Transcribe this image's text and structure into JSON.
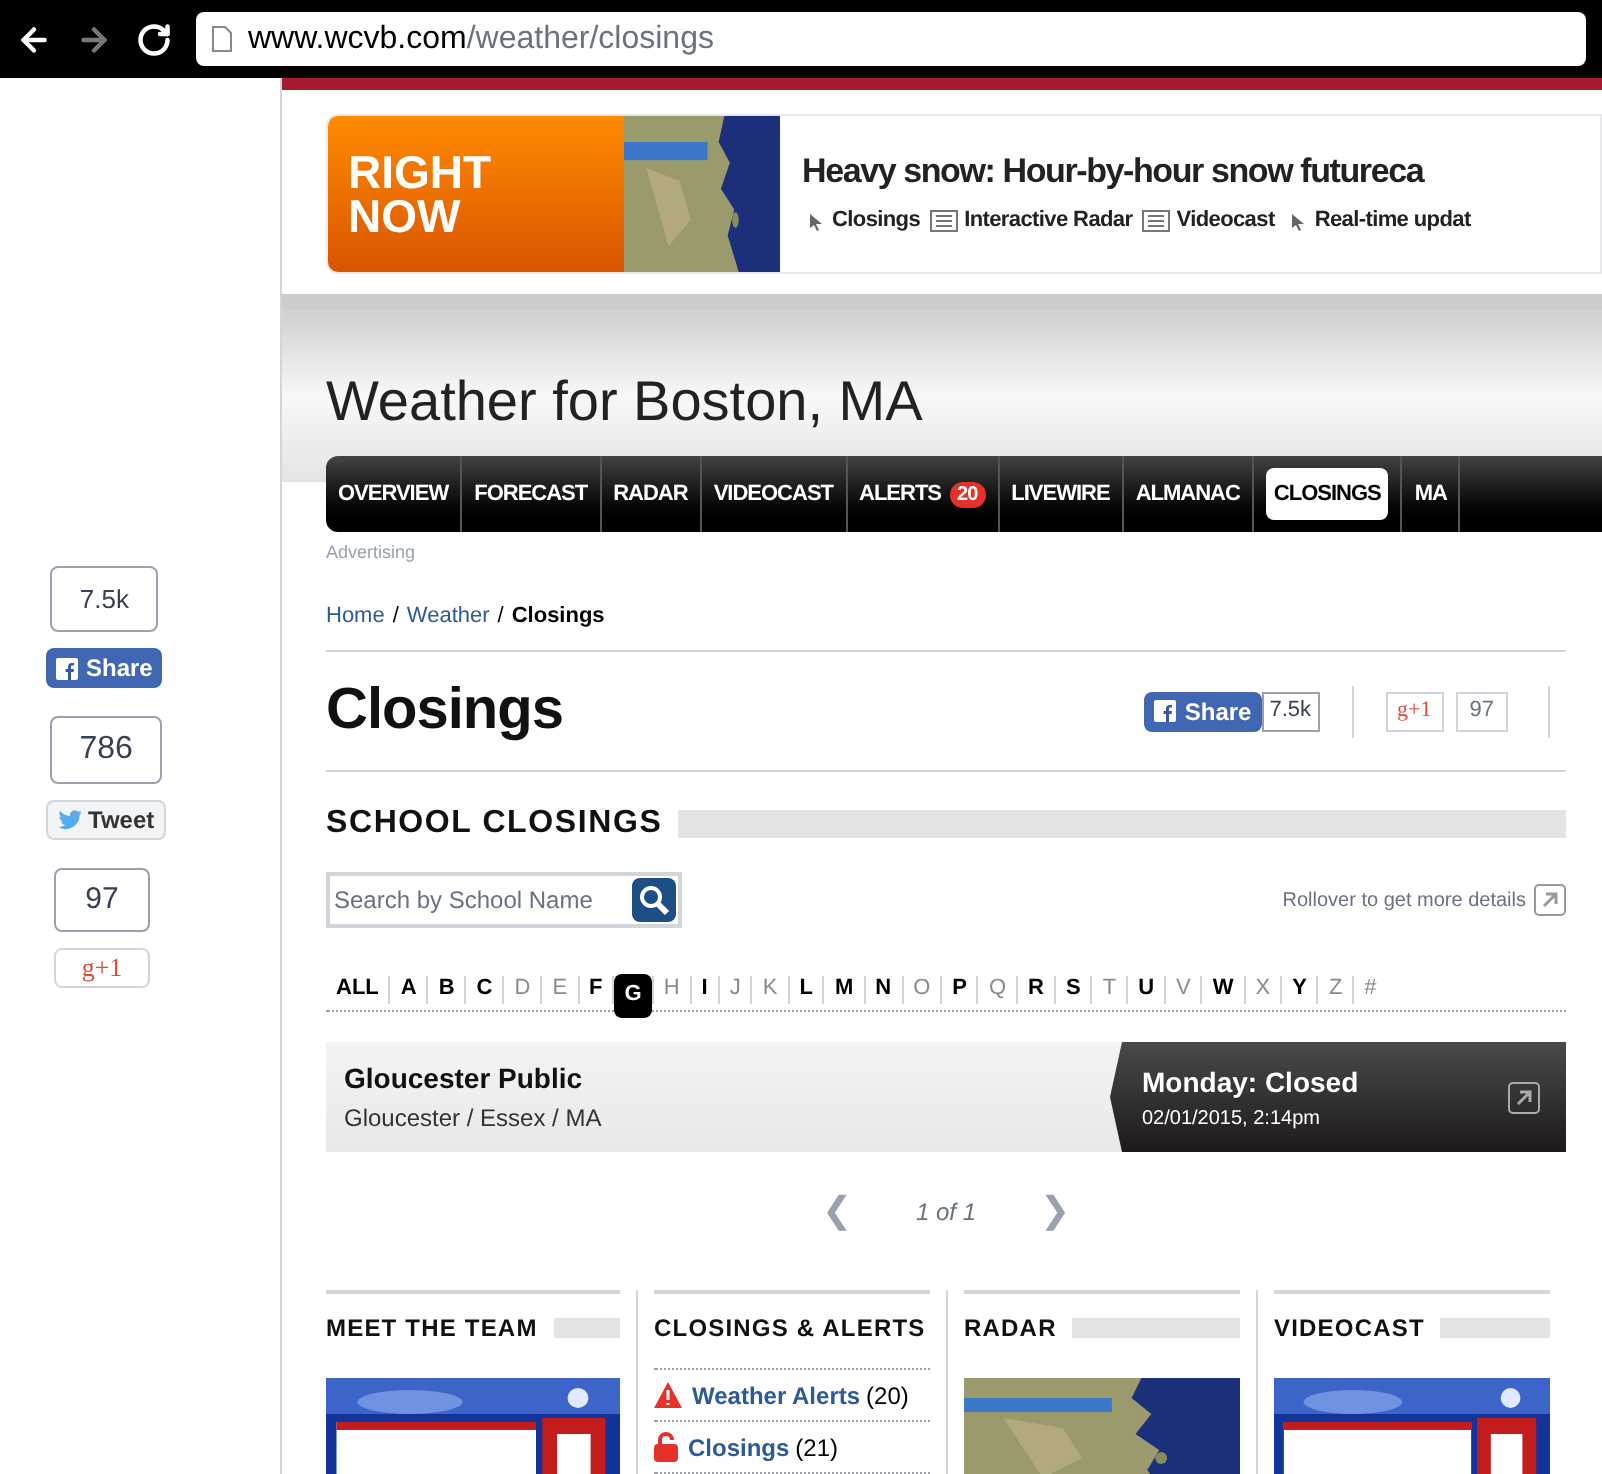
{
  "browser": {
    "url_host": "www.wcvb.com",
    "url_path": "/weather/closings"
  },
  "side_share": [
    {
      "kind": "facebook",
      "count": "7.5k",
      "label": "Share"
    },
    {
      "kind": "twitter",
      "count": "786",
      "label": "Tweet"
    },
    {
      "kind": "google",
      "count": "97",
      "label": "g+1"
    }
  ],
  "right_now": {
    "label": "RIGHT NOW",
    "headline": "Heavy snow: Hour-by-hour snow futureca",
    "links": [
      {
        "kind": "pointer",
        "label": "Closings"
      },
      {
        "kind": "article",
        "label": "Interactive Radar"
      },
      {
        "kind": "article",
        "label": "Videocast"
      },
      {
        "kind": "pointer",
        "label": "Real-time updat"
      }
    ]
  },
  "page_title": "Weather for Boston, MA",
  "nav": [
    {
      "label": "OVERVIEW",
      "selected": false
    },
    {
      "label": "FORECAST",
      "selected": false
    },
    {
      "label": "RADAR",
      "selected": false
    },
    {
      "label": "VIDEOCAST",
      "selected": false
    },
    {
      "label": "ALERTS",
      "badge": "20",
      "selected": false
    },
    {
      "label": "LIVEWIRE",
      "selected": false
    },
    {
      "label": "ALMANAC",
      "selected": false
    },
    {
      "label": "CLOSINGS",
      "selected": true
    },
    {
      "label": "MA",
      "selected": false
    }
  ],
  "advertising": "Advertising",
  "breadcrumb": [
    {
      "label": "Home",
      "current": false
    },
    {
      "separator": "/",
      "label": "Weather",
      "current": false
    },
    {
      "separator": "/",
      "label": "Closings",
      "current": true
    }
  ],
  "heading": "Closings",
  "share": {
    "facebook_label": "Share",
    "facebook_count": "7.5k",
    "google_label": "g+1",
    "google_count": "97"
  },
  "section_title": "SCHOOL CLOSINGS",
  "search": {
    "placeholder": "Search by School Name"
  },
  "rollover_hint": "Rollover to get more details",
  "letters": [
    {
      "label": "ALL",
      "disabled": false,
      "selected": false
    },
    {
      "label": "A",
      "disabled": false,
      "selected": false
    },
    {
      "label": "B",
      "disabled": false,
      "selected": false
    },
    {
      "label": "C",
      "disabled": false,
      "selected": false
    },
    {
      "label": "D",
      "disabled": true,
      "selected": false
    },
    {
      "label": "E",
      "disabled": true,
      "selected": false
    },
    {
      "label": "F",
      "disabled": false,
      "selected": false
    },
    {
      "label": "G",
      "disabled": false,
      "selected": true
    },
    {
      "label": "H",
      "disabled": true,
      "selected": false
    },
    {
      "label": "I",
      "disabled": false,
      "selected": false
    },
    {
      "label": "J",
      "disabled": true,
      "selected": false
    },
    {
      "label": "K",
      "disabled": true,
      "selected": false
    },
    {
      "label": "L",
      "disabled": false,
      "selected": false
    },
    {
      "label": "M",
      "disabled": false,
      "selected": false
    },
    {
      "label": "N",
      "disabled": false,
      "selected": false
    },
    {
      "label": "O",
      "disabled": true,
      "selected": false
    },
    {
      "label": "P",
      "disabled": false,
      "selected": false
    },
    {
      "label": "Q",
      "disabled": true,
      "selected": false
    },
    {
      "label": "R",
      "disabled": false,
      "selected": false
    },
    {
      "label": "S",
      "disabled": false,
      "selected": false
    },
    {
      "label": "T",
      "disabled": true,
      "selected": false
    },
    {
      "label": "U",
      "disabled": false,
      "selected": false
    },
    {
      "label": "V",
      "disabled": true,
      "selected": false
    },
    {
      "label": "W",
      "disabled": false,
      "selected": false
    },
    {
      "label": "X",
      "disabled": true,
      "selected": false
    },
    {
      "label": "Y",
      "disabled": false,
      "selected": false
    },
    {
      "label": "Z",
      "disabled": true,
      "selected": false
    },
    {
      "label": "#",
      "disabled": true,
      "selected": false
    }
  ],
  "results": [
    {
      "name": "Gloucester Public",
      "location": "Gloucester / Essex / MA",
      "status": "Monday: Closed",
      "updated": "02/01/2015, 2:14pm"
    }
  ],
  "pagination": {
    "prev": "❮",
    "text": "1 of 1",
    "next": "❯"
  },
  "columns": [
    {
      "title": "MEET THE TEAM",
      "kind": "picture"
    },
    {
      "title": "CLOSINGS & ALERTS",
      "kind": "links",
      "links": [
        {
          "kind": "alert",
          "label": "Weather Alerts",
          "count": "(20)"
        },
        {
          "kind": "lock",
          "label": "Closings",
          "count": "(21)"
        }
      ]
    },
    {
      "title": "RADAR",
      "kind": "map"
    },
    {
      "title": "VIDEOCAST",
      "kind": "picture"
    }
  ]
}
